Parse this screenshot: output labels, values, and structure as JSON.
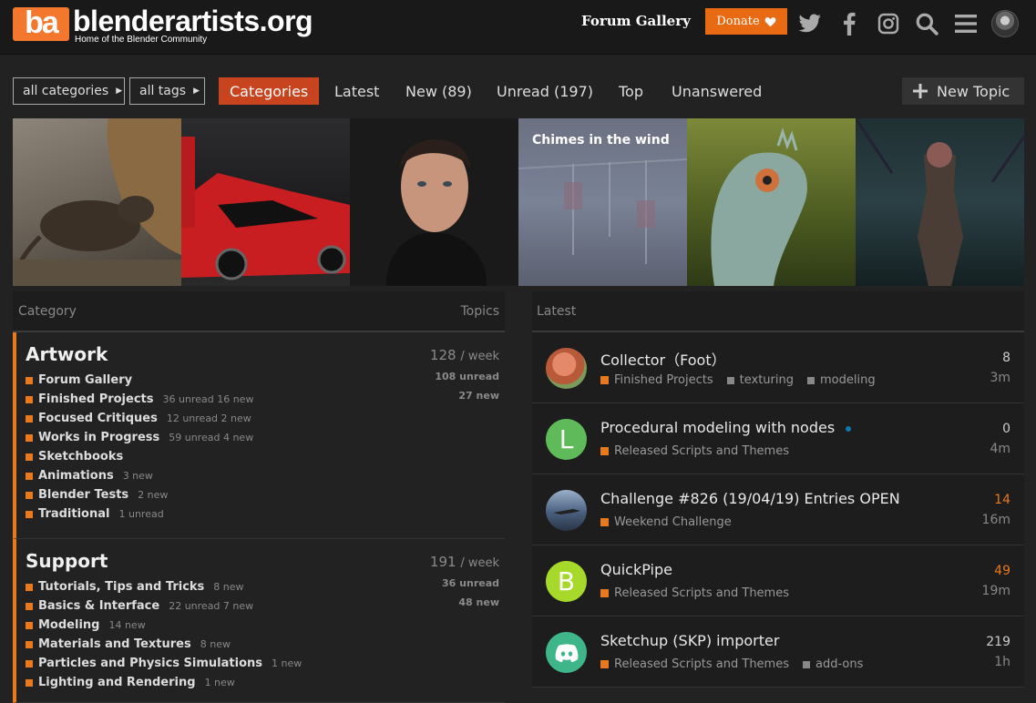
{
  "header": {
    "logo_mark": "ba",
    "site_name": "blenderartists.org",
    "tagline": "Home of the Blender Community",
    "forum_gallery": "Forum Gallery",
    "donate": "Donate",
    "icons": [
      "twitter-icon",
      "facebook-icon",
      "instagram-icon",
      "search-icon",
      "hamburger-icon",
      "user-avatar"
    ]
  },
  "nav": {
    "all_categories": "all categories",
    "all_tags": "all tags",
    "tabs": [
      "Categories",
      "Latest",
      "New (89)",
      "Unread (197)",
      "Top",
      "Unanswered"
    ],
    "new_topic": "New Topic"
  },
  "banner": {
    "caption": "Chimes in the wind"
  },
  "categories": {
    "header_category": "Category",
    "header_topics": "Topics",
    "blocks": [
      {
        "title": "Artwork",
        "week_count": "128",
        "week_label": "/ week",
        "unread": "108 unread",
        "new": "27 new",
        "subcats": [
          {
            "name": "Forum Gallery",
            "meta": ""
          },
          {
            "name": "Finished Projects",
            "meta": "36 unread 16 new"
          },
          {
            "name": "Focused Critiques",
            "meta": "12 unread 2 new"
          },
          {
            "name": "Works in Progress",
            "meta": "59 unread 4 new"
          },
          {
            "name": "Sketchbooks",
            "meta": ""
          },
          {
            "name": "Animations",
            "meta": "3 new"
          },
          {
            "name": "Blender Tests",
            "meta": "2 new"
          },
          {
            "name": "Traditional",
            "meta": "1 unread"
          }
        ]
      },
      {
        "title": "Support",
        "week_count": "191",
        "week_label": "/ week",
        "unread": "36 unread",
        "new": "48 new",
        "subcats": [
          {
            "name": "Tutorials, Tips and Tricks",
            "meta": "8 new"
          },
          {
            "name": "Basics & Interface",
            "meta": "22 unread 7 new"
          },
          {
            "name": "Modeling",
            "meta": "14 new"
          },
          {
            "name": "Materials and Textures",
            "meta": "8 new"
          },
          {
            "name": "Particles and Physics Simulations",
            "meta": "1 new"
          },
          {
            "name": "Lighting and Rendering",
            "meta": "1 new"
          }
        ]
      }
    ]
  },
  "latest": {
    "header": "Latest",
    "topics": [
      {
        "title": "Collector（Foot）",
        "category": "Finished Projects",
        "tags": [
          "texturing",
          "modeling"
        ],
        "replies": "8",
        "age": "3m",
        "avatar_letter": "",
        "avatar_color": "#d8674a"
      },
      {
        "title": "Procedural modeling with nodes",
        "category": "Released Scripts and Themes",
        "tags": [],
        "replies": "0",
        "age": "4m",
        "avatar_letter": "L",
        "avatar_color": "#5fbb5a"
      },
      {
        "title": "Challenge #826 (19/04/19) Entries OPEN",
        "category": "Weekend Challenge",
        "tags": [],
        "replies": "14",
        "age": "16m",
        "avatar_letter": "",
        "avatar_color": "#4a6080"
      },
      {
        "title": "QuickPipe",
        "category": "Released Scripts and Themes",
        "tags": [],
        "replies": "49",
        "age": "19m",
        "avatar_letter": "B",
        "avatar_color": "#a6d92a"
      },
      {
        "title": "Sketchup (SKP) importer",
        "category": "Released Scripts and Themes",
        "tags": [
          "add-ons"
        ],
        "replies": "219",
        "age": "1h",
        "avatar_letter": "",
        "avatar_color": "#3fb58a"
      }
    ]
  },
  "colors": {
    "accent": "#e8791d",
    "active_tab": "#c8441f",
    "donate": "#e86a12",
    "hot_replies": "#e8791d"
  }
}
